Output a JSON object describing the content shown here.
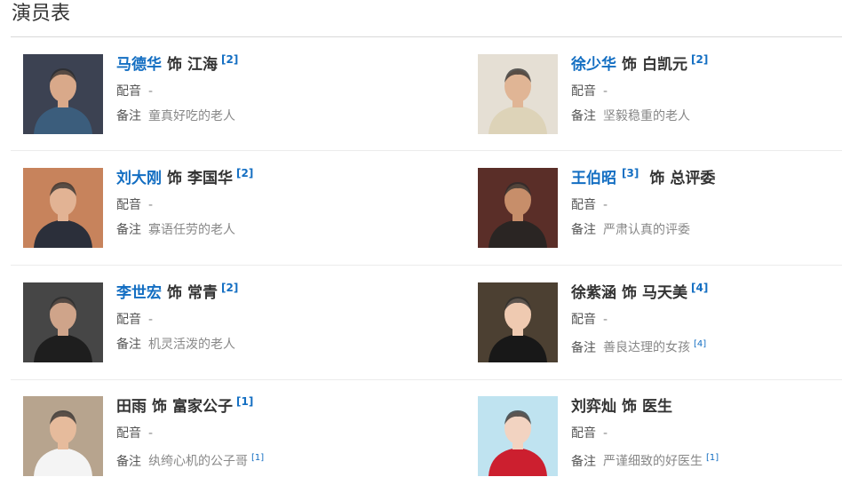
{
  "section_title": "演员表",
  "separator_word": "饰",
  "labels": {
    "dub": "配音",
    "note": "备注"
  },
  "cast": [
    {
      "actor": "马德华",
      "role": "江海",
      "role_ref": "[2]",
      "dub": "-",
      "note": "童真好吃的老人",
      "linked": true,
      "bg": "#3c4252",
      "skin": "#d9a98a",
      "shirt": "#3b5d7c"
    },
    {
      "actor": "徐少华",
      "role": "白凯元",
      "role_ref": "[2]",
      "dub": "-",
      "note": "坚毅稳重的老人",
      "linked": true,
      "bg": "#e5dfd4",
      "skin": "#e0b595",
      "shirt": "#ddd3b8"
    },
    {
      "actor": "刘大刚",
      "role": "李国华",
      "role_ref": "[2]",
      "dub": "-",
      "note": "寡语任劳的老人",
      "linked": true,
      "bg": "#c7835c",
      "skin": "#e2b394",
      "shirt": "#2b2f3a"
    },
    {
      "actor": "王伯昭",
      "actor_ref": "[3]",
      "role": "总评委",
      "dub": "-",
      "note": "严肃认真的评委",
      "linked": true,
      "bg": "#5a2e28",
      "skin": "#c78e6a",
      "shirt": "#2a2523"
    },
    {
      "actor": "李世宏",
      "role": "常青",
      "role_ref": "[2]",
      "dub": "-",
      "note": "机灵活泼的老人",
      "linked": true,
      "bg": "#464646",
      "skin": "#cfa48a",
      "shirt": "#1e1e1e"
    },
    {
      "actor": "徐紫涵",
      "role": "马天美",
      "role_ref": "[4]",
      "dub": "-",
      "note": "善良达理的女孩",
      "note_ref": "[4]",
      "linked": false,
      "bg": "#4c4032",
      "skin": "#efcab1",
      "shirt": "#181818"
    },
    {
      "actor": "田雨",
      "role": "富家公子",
      "role_ref": "[1]",
      "dub": "-",
      "note": "纨绔心机的公子哥",
      "note_ref": "[1]",
      "linked": false,
      "bg": "#b7a48e",
      "skin": "#e6bb9c",
      "shirt": "#f4f4f4"
    },
    {
      "actor": "刘弈灿",
      "role": "医生",
      "dub": "-",
      "note": "严谨细致的好医生",
      "note_ref": "[1]",
      "linked": false,
      "bg": "#bfe3f0",
      "skin": "#f2d3c1",
      "shirt": "#cc1f2f"
    }
  ]
}
